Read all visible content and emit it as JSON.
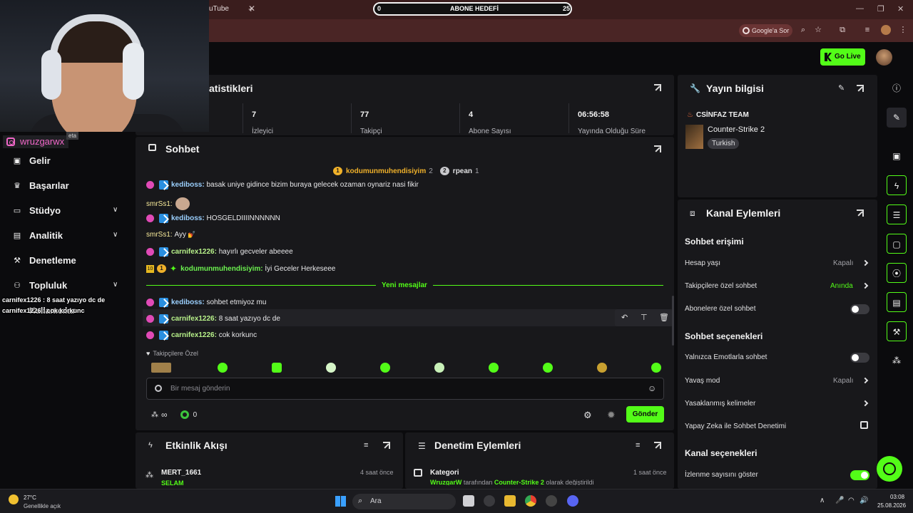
{
  "browser": {
    "tab_partial": "uTube",
    "goal": {
      "start": "0",
      "label": "ABONE HEDEFİ",
      "end": "25"
    },
    "google_sor": "Google'a Sor"
  },
  "overlay": {
    "instagram": "wruzgarwx",
    "tag": "eta",
    "chat_overlay_1": "carnifex1226 : 8 saat yazıyo dc de",
    "chat_overlay_2": "carnifex1226 : cok korkunc"
  },
  "header": {
    "go_live": "Go Live"
  },
  "sidebar": {
    "items": [
      {
        "label": "Gelir"
      },
      {
        "label": "Başarılar"
      },
      {
        "label": "Stüdyo"
      },
      {
        "label": "Analitik"
      },
      {
        "label": "Denetleme"
      },
      {
        "label": "Topluluk"
      }
    ],
    "partial": "Kullanıcılar"
  },
  "stats": {
    "title": "atistikleri",
    "items": [
      {
        "value": "7",
        "label": "İzleyici"
      },
      {
        "value": "77",
        "label": "Takipçi"
      },
      {
        "value": "4",
        "label": "Abone Sayısı"
      },
      {
        "value": "06:56:58",
        "label": "Yayında Olduğu Süre"
      }
    ]
  },
  "chat": {
    "title": "Sohbet",
    "top_gifters": [
      {
        "rank": "1",
        "name": "kodumunmuhendisiyim",
        "count": "2"
      },
      {
        "rank": "2",
        "name": "rpean",
        "count": "1"
      }
    ],
    "messages": [
      {
        "user": "kediboss:",
        "text": "basak uniye gidince bizim buraya gelecek ozaman oynariz nasi fikir"
      },
      {
        "user": "smrSs1:",
        "text": ""
      },
      {
        "user": "kediboss:",
        "text": "HOSGELDIIIINNNNNN"
      },
      {
        "user": "smrSs1:",
        "text": "Ayy"
      },
      {
        "user": "carnifex1226:",
        "text": "hayırlı gecveler abeeee"
      },
      {
        "user": "kodumunmuhendisiyim:",
        "text": "İyi Geceler Herkeseee",
        "badge_num": "10",
        "badge_rank": "1"
      },
      {
        "user": "kediboss:",
        "text": "sohbet etmiyoz mu"
      },
      {
        "user": "carnifex1226:",
        "text": "8 saat yazıyo dc de"
      },
      {
        "user": "carnifex1226:",
        "text": "cok korkunc"
      }
    ],
    "new_messages": "Yeni mesajlar",
    "followers_only": "Takipçilere Özel",
    "placeholder": "Bir mesaj gönderin",
    "infinity": "∞",
    "points": "0",
    "send": "Gönder"
  },
  "stream_info": {
    "title": "Yayın bilgisi",
    "stream_title": "CSİNFAZ TEAM",
    "category": "Counter-Strike 2",
    "tag": "Turkish"
  },
  "channel_actions": {
    "title": "Kanal Eylemleri",
    "chat_access": "Sohbet erişimi",
    "account_age": {
      "label": "Hesap yaşı",
      "value": "Kapalı"
    },
    "followers_chat": {
      "label": "Takipçilere özel sohbet",
      "value": "Anında"
    },
    "subs_chat": {
      "label": "Abonelere özel sohbet"
    },
    "chat_options": "Sohbet seçenekleri",
    "emote_only": {
      "label": "Yalnızca Emotlarla sohbet"
    },
    "slow_mode": {
      "label": "Yavaş mod",
      "value": "Kapalı"
    },
    "banned_words": {
      "label": "Yasaklanmış kelimeler"
    },
    "ai_moderation": {
      "label": "Yapay Zeka ile Sohbet Denetimi"
    },
    "channel_options": "Kanal seçenekleri",
    "show_viewers": {
      "label": "İzlenme sayısını göster"
    }
  },
  "activity": {
    "title": "Etkinlik Akışı",
    "item": {
      "user": "MERT_1661",
      "time": "4 saat önce",
      "text": "SELAM"
    }
  },
  "moderation": {
    "title": "Denetim Eylemleri",
    "item": {
      "title": "Kategori",
      "time": "1 saat önce",
      "user": "WruzgarW",
      "mid": "tarafından",
      "category": "Counter-Strike 2",
      "end": "olarak değiştirildi"
    }
  },
  "taskbar": {
    "weather_temp": "27°C",
    "weather_text": "Genellikle açık",
    "search": "Ara",
    "time": "03:08",
    "date": "25.08.2026"
  },
  "colors": {
    "accent": "#53fc18",
    "bg": "#0b0b0d",
    "panel": "#18181b",
    "pink_badge": "#e04ab6"
  }
}
